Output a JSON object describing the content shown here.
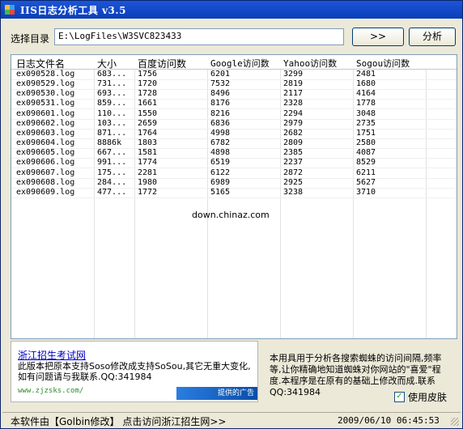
{
  "window": {
    "title": "IIS日志分析工具 v3.5"
  },
  "toolbar": {
    "dir_label": "选择目录",
    "path_value": "E:\\LogFiles\\W3SVC823433",
    "browse_label": ">>",
    "analyze_label": "分析"
  },
  "table": {
    "columns": [
      "日志文件名",
      "大小",
      "百度访问数",
      "Google访问数",
      "Yahoo访问数",
      "Sogou访问数"
    ],
    "rows": [
      [
        "ex090528.log",
        "683...",
        "1756",
        "6201",
        "3299",
        "2481"
      ],
      [
        "ex090529.log",
        "731...",
        "1720",
        "7532",
        "2819",
        "1680"
      ],
      [
        "ex090530.log",
        "693...",
        "1728",
        "8496",
        "2117",
        "4164"
      ],
      [
        "ex090531.log",
        "859...",
        "1661",
        "8176",
        "2328",
        "1778"
      ],
      [
        "ex090601.log",
        "110...",
        "1550",
        "8216",
        "2294",
        "3048"
      ],
      [
        "ex090602.log",
        "103...",
        "2659",
        "6836",
        "2979",
        "2735"
      ],
      [
        "ex090603.log",
        "871...",
        "1764",
        "4998",
        "2682",
        "1751"
      ],
      [
        "ex090604.log",
        "8886k",
        "1803",
        "6782",
        "2809",
        "2580"
      ],
      [
        "ex090605.log",
        "667...",
        "1581",
        "4898",
        "2385",
        "4087"
      ],
      [
        "ex090606.log",
        "991...",
        "1774",
        "6519",
        "2237",
        "8529"
      ],
      [
        "ex090607.log",
        "175...",
        "2281",
        "6122",
        "2872",
        "6211"
      ],
      [
        "ex090608.log",
        "284...",
        "1980",
        "6989",
        "2925",
        "5627"
      ],
      [
        "ex090609.log",
        "477...",
        "1772",
        "5165",
        "3238",
        "3710"
      ]
    ]
  },
  "watermark": "down.chinaz.com",
  "ad": {
    "link": "浙江招生考试网",
    "text": "此版本把原本支持Soso修改成支持SoSou,其它无重大变化,如有问题请与我联系.QQ:341984",
    "url": "www.zjzsks.com/",
    "banner": "提供的广告"
  },
  "description": "本用具用于分析各搜索蜘蛛的访问间隔,频率等,让你精确地知道蜘蛛对你网站的\"喜爱\"程度.本程序是在原有的基础上修改而成.联系QQ:341984",
  "skin": {
    "label": "使用皮肤",
    "checked": true
  },
  "status": {
    "left": "本软件由【Golbin修改】 点击访问浙江招生网>>",
    "datetime": "2009/06/10 06:45:53"
  }
}
